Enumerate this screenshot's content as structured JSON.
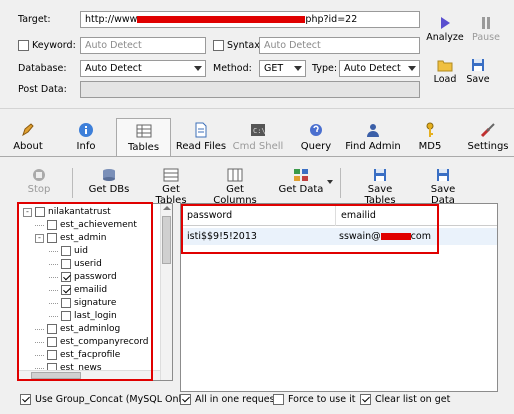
{
  "target": {
    "label": "Target:",
    "url_prefix": "http://www",
    "url_suffix": "php?id=22"
  },
  "keyword": {
    "label": "Keyword:",
    "value": "Auto Detect"
  },
  "syntax": {
    "label": "Syntax:",
    "value": "Auto Detect"
  },
  "database": {
    "label": "Database:",
    "value": "Auto Detect"
  },
  "method": {
    "label": "Method:",
    "value": "GET"
  },
  "type": {
    "label": "Type:",
    "value": "Auto Detect"
  },
  "post_data": {
    "label": "Post Data:",
    "value": ""
  },
  "side_buttons": {
    "analyze": "Analyze",
    "pause": "Pause",
    "load": "Load",
    "save": "Save"
  },
  "tabs": [
    {
      "label": "About",
      "icon": "pen-icon"
    },
    {
      "label": "Info",
      "icon": "info-icon"
    },
    {
      "label": "Tables",
      "icon": "table-icon"
    },
    {
      "label": "Read Files",
      "icon": "file-icon"
    },
    {
      "label": "Cmd Shell",
      "icon": "terminal-icon"
    },
    {
      "label": "Query",
      "icon": "query-icon"
    },
    {
      "label": "Find Admin",
      "icon": "admin-icon"
    },
    {
      "label": "MD5",
      "icon": "key-icon"
    },
    {
      "label": "Settings",
      "icon": "tools-icon"
    }
  ],
  "toolbar": {
    "stop": "Stop",
    "get_dbs": "Get DBs",
    "get_tables": "Get Tables",
    "get_columns": "Get Columns",
    "get_data": "Get Data",
    "save_tables": "Save Tables",
    "save_data": "Save Data"
  },
  "tree": {
    "database": "nilakantatrust",
    "items": [
      {
        "name": "est_achievement",
        "level": 1,
        "checked": false,
        "expander": ""
      },
      {
        "name": "est_admin",
        "level": 1,
        "checked": false,
        "expander": "-"
      },
      {
        "name": "uid",
        "level": 2,
        "checked": false,
        "expander": ""
      },
      {
        "name": "userid",
        "level": 2,
        "checked": false,
        "expander": ""
      },
      {
        "name": "password",
        "level": 2,
        "checked": true,
        "expander": ""
      },
      {
        "name": "emailid",
        "level": 2,
        "checked": true,
        "expander": ""
      },
      {
        "name": "signature",
        "level": 2,
        "checked": false,
        "expander": ""
      },
      {
        "name": "last_login",
        "level": 2,
        "checked": false,
        "expander": ""
      },
      {
        "name": "est_adminlog",
        "level": 1,
        "checked": false,
        "expander": ""
      },
      {
        "name": "est_companyrecord",
        "level": 1,
        "checked": false,
        "expander": ""
      },
      {
        "name": "est_facprofile",
        "level": 1,
        "checked": false,
        "expander": ""
      },
      {
        "name": "est_news",
        "level": 1,
        "checked": false,
        "expander": ""
      }
    ]
  },
  "results": {
    "columns": [
      "password",
      "emailid"
    ],
    "rows": [
      {
        "password": "isti$$9!5!2013",
        "email_prefix": "sswain@",
        "email_suffix": "com"
      }
    ]
  },
  "bottom": {
    "group_concat": "Use Group_Concat (MySQL Only)",
    "all_in_one": "All in one request.",
    "force": "Force to use it",
    "clear_list": "Clear list on get"
  },
  "colors": {
    "redaction": "#e00000",
    "highlight": "#e00000"
  }
}
